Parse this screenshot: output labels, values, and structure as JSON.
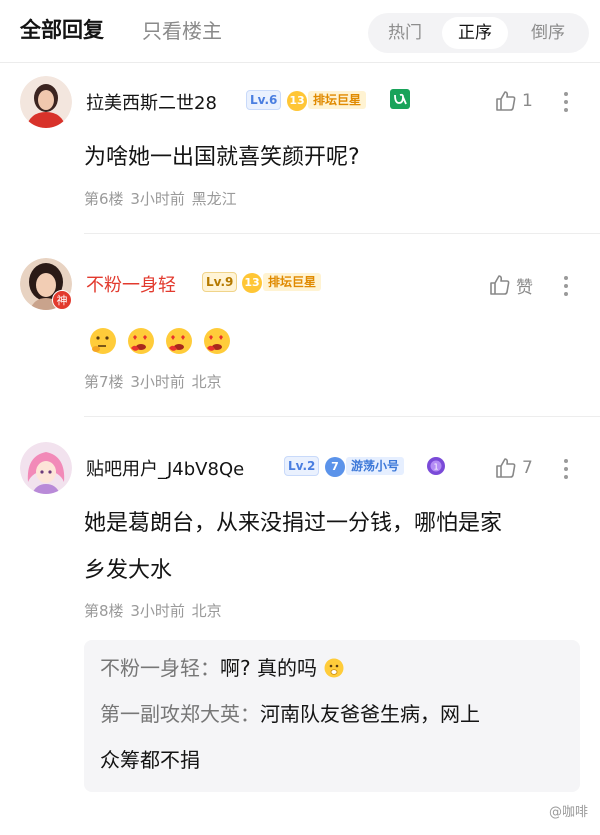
{
  "header": {
    "tab_all": "全部回复",
    "tab_op_only": "只看楼主",
    "sort_options": [
      "热门",
      "正序",
      "倒序"
    ],
    "sort_selected": "正序"
  },
  "posts": [
    {
      "username": "拉美西斯二世28",
      "level": "Lv.6",
      "badge_num": "13",
      "badge_text": "排坛巨星",
      "extra_icon": "zodiac-badge-icon",
      "likes": "1",
      "content": "为啥她一出国就喜笑颜开呢?",
      "floor": "第6楼",
      "time": "3小时前",
      "location": "黑龙江"
    },
    {
      "username": "不粉一身轻",
      "level": "Lv.9",
      "badge_num": "13",
      "badge_text": "排坛巨星",
      "avatar_tag": "神",
      "likes": "赞",
      "content_emojis": [
        "thinking-face-icon",
        "heart-eyes-face-icon",
        "heart-eyes-face-icon",
        "heart-eyes-face-icon"
      ],
      "floor": "第7楼",
      "time": "3小时前",
      "location": "北京"
    },
    {
      "username": "贴吧用户_J4bV8Qe",
      "level": "Lv.2",
      "badge_num": "7",
      "badge_text": "游荡小号",
      "extra_icon": "purple-medal-icon",
      "likes": "7",
      "content_line1": "她是葛朗台，从来没捐过一分钱，哪怕是家",
      "content_line2": "乡发大水",
      "floor": "第8楼",
      "time": "3小时前",
      "location": "北京",
      "replies": [
        {
          "name": "不粉一身轻：",
          "text": "啊? 真的吗"
        },
        {
          "name": "第一副攻郑大英：",
          "text": "河南队友爸爸生病，网上",
          "text2": "众筹都不捐"
        }
      ]
    }
  ],
  "watermark": "@咖啡",
  "colors": {
    "accent_red": "#e23a2e",
    "level_blue": "#4a7ee0",
    "badge_gold": "#ffc636",
    "quote_bg": "#f5f5f7"
  }
}
